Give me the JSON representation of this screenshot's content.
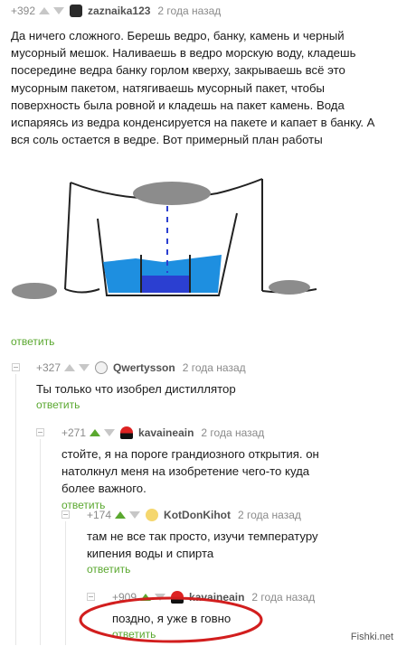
{
  "comments": [
    {
      "rating": "+392",
      "username": "zaznaika123",
      "time": "2 года назад",
      "text": "Да ничего сложного. Берешь ведро, банку, камень и черный мусорный мешок. Наливаешь в ведро морскую воду, кладешь посередине ведра банку горлом кверху, закрываешь всё это мусорным пакетом, натягиваешь мусорный пакет, чтобы поверхность была ровной и кладешь на пакет камень. Вода испаряясь из ведра конденсируется на пакете и капает в банку. А вся соль остается в ведре. Вот примерный план работы",
      "reply": "ответить"
    },
    {
      "rating": "+327",
      "username": "Qwertysson",
      "time": "2 года назад",
      "text": "Ты только что изобрел дистиллятор",
      "reply": "ответить"
    },
    {
      "rating": "+271",
      "username": "kavaineain",
      "time": "2 года назад",
      "text": "стойте, я на пороге грандиозного открытия. он натолкнул меня на изобретение чего-то куда более важного.",
      "reply": "ответить"
    },
    {
      "rating": "+174",
      "username": "KotDonKihot",
      "time": "2 года назад",
      "text": "там не все так просто, изучи температуру кипения воды и спирта",
      "reply": "ответить"
    },
    {
      "rating": "+909",
      "username": "kavaineain",
      "time": "2 года назад",
      "text": "поздно, я уже в говно",
      "reply": "ответить"
    }
  ],
  "watermark": "Fishki.net",
  "colors": {
    "reply_green": "#5aa82f",
    "water_blue": "#1e8fe0",
    "water_dark": "#2b3fd1",
    "stone_gray": "#8c8c8c",
    "circle_red": "#d21e1e"
  }
}
